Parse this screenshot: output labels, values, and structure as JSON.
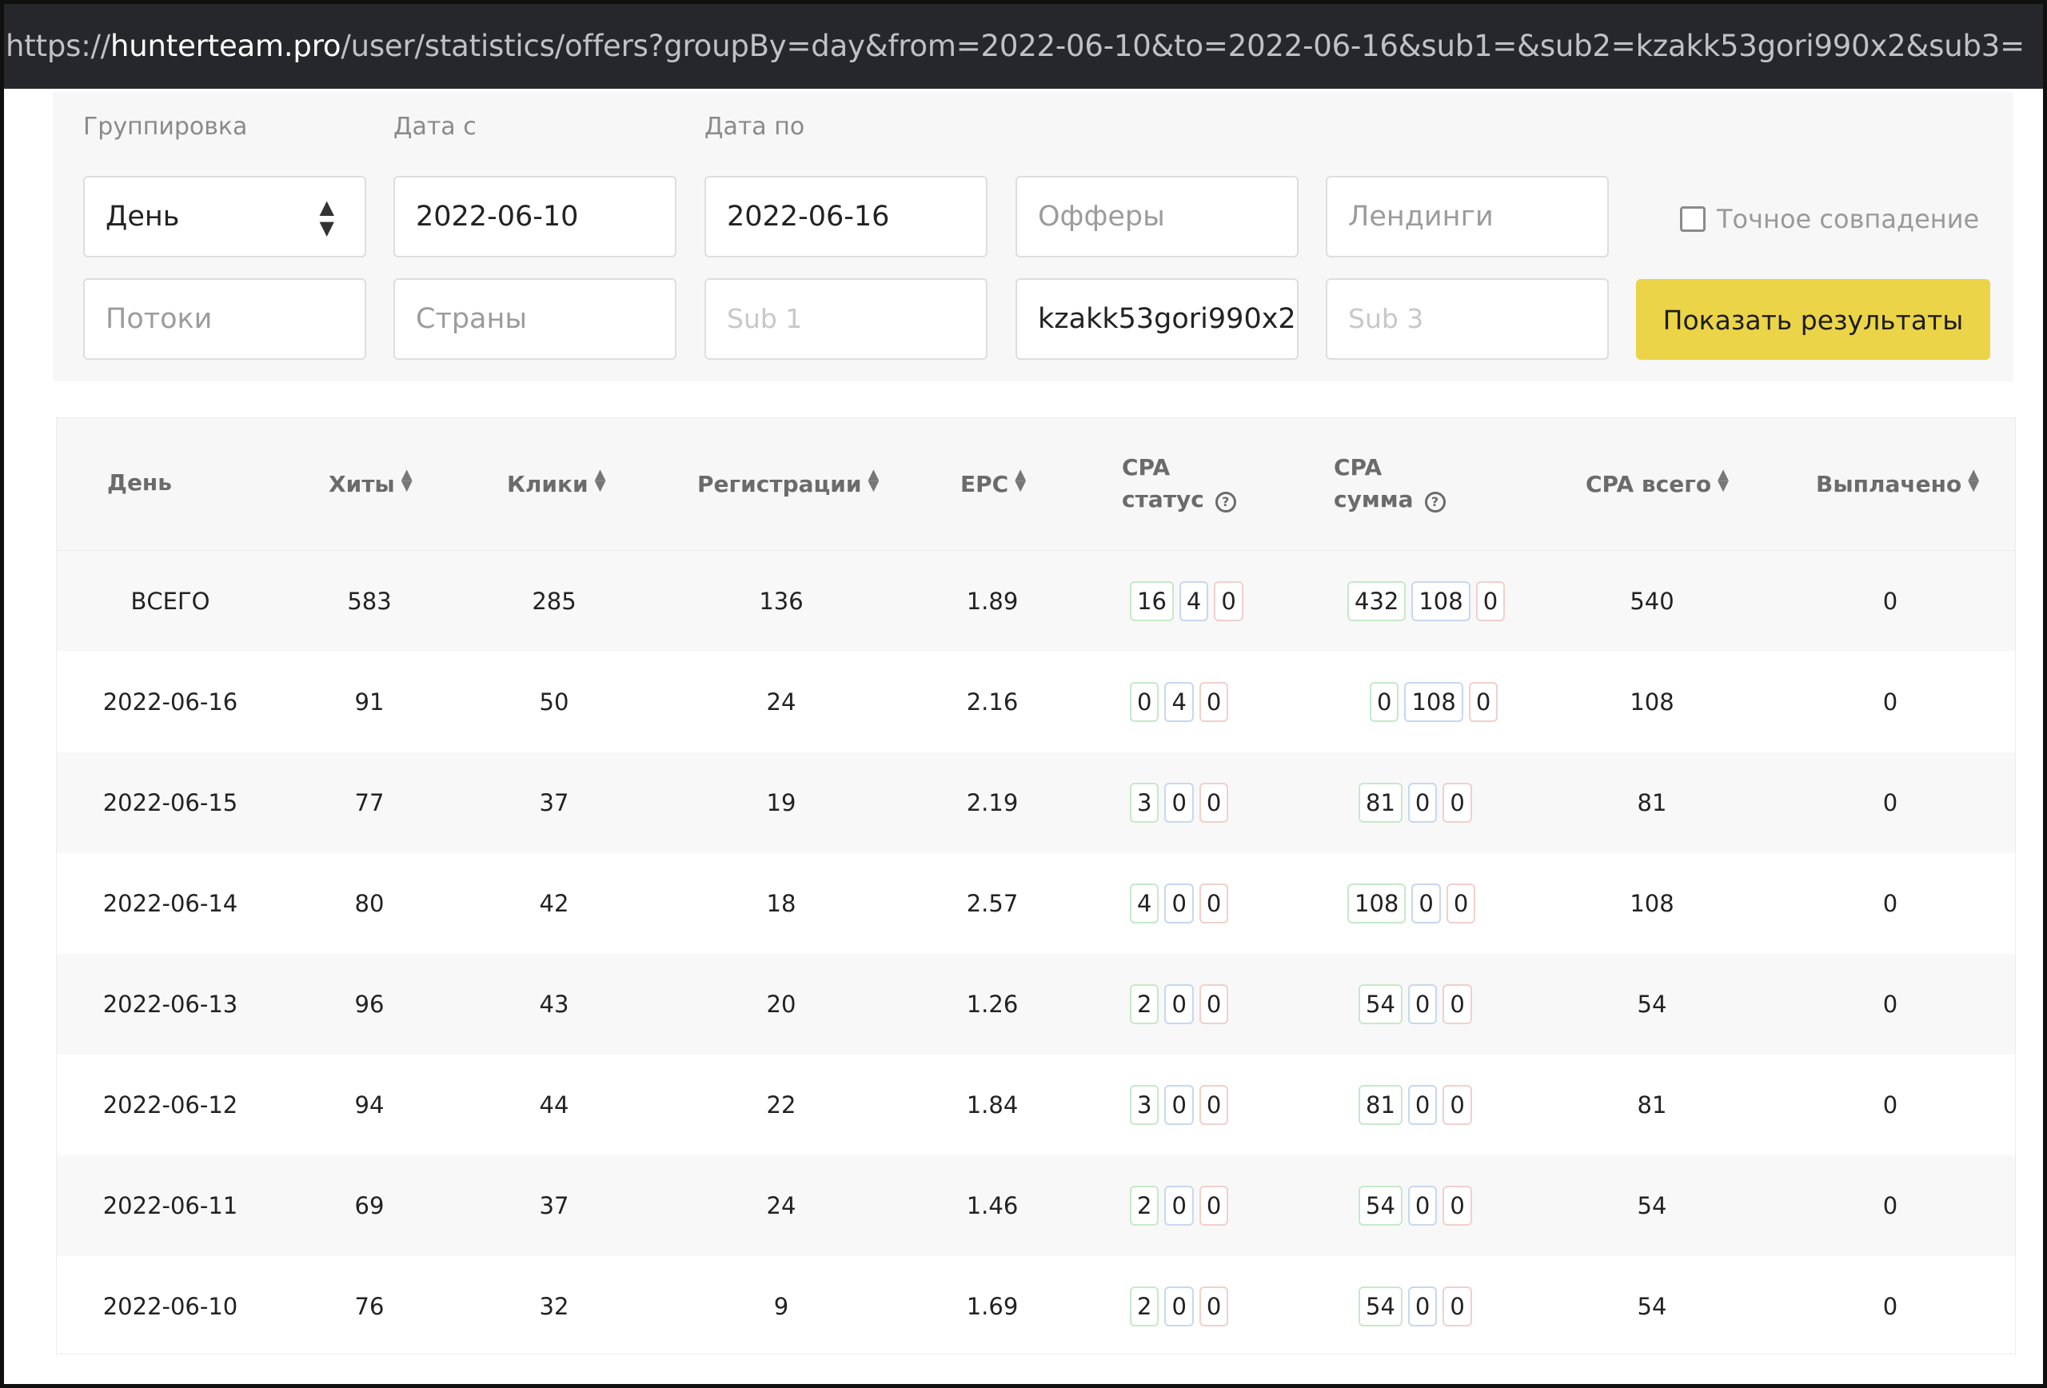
{
  "url": {
    "prefix": "https://",
    "host": "hunterteam.pro",
    "path": "/user/statistics/offers?groupBy=day&from=2022-06-10&to=2022-06-16&sub1=&sub2=kzakk53gori990x2&sub3="
  },
  "filters": {
    "grouping_label": "Группировка",
    "grouping_value": "День",
    "date_from_label": "Дата с",
    "date_from_value": "2022-06-10",
    "date_to_label": "Дата по",
    "date_to_value": "2022-06-16",
    "offers_placeholder": "Офферы",
    "landings_placeholder": "Лендинги",
    "exact_match_label": "Точное совпадение",
    "streams_placeholder": "Потоки",
    "countries_placeholder": "Страны",
    "sub1_placeholder": "Sub 1",
    "sub2_value": "kzakk53gori990x2",
    "sub3_placeholder": "Sub 3",
    "show_button": "Показать результаты"
  },
  "table": {
    "headers": {
      "day": "День",
      "hits": "Хиты",
      "clicks": "Клики",
      "registrations": "Регистрации",
      "epc": "EPC",
      "cpa_status_1": "CPA",
      "cpa_status_2": "статус",
      "cpa_sum_1": "CPA",
      "cpa_sum_2": "сумма",
      "cpa_total": "CPA всего",
      "paid": "Выплачено"
    },
    "rows": [
      {
        "day": "ВСЕГО",
        "hits": "583",
        "clicks": "285",
        "regs": "136",
        "epc": "1.89",
        "st": [
          "16",
          "4",
          "0"
        ],
        "sum": [
          "432",
          "108",
          "0"
        ],
        "total": "540",
        "paid": "0"
      },
      {
        "day": "2022-06-16",
        "hits": "91",
        "clicks": "50",
        "regs": "24",
        "epc": "2.16",
        "st": [
          "0",
          "4",
          "0"
        ],
        "sum": [
          "0",
          "108",
          "0"
        ],
        "total": "108",
        "paid": "0"
      },
      {
        "day": "2022-06-15",
        "hits": "77",
        "clicks": "37",
        "regs": "19",
        "epc": "2.19",
        "st": [
          "3",
          "0",
          "0"
        ],
        "sum": [
          "81",
          "0",
          "0"
        ],
        "total": "81",
        "paid": "0"
      },
      {
        "day": "2022-06-14",
        "hits": "80",
        "clicks": "42",
        "regs": "18",
        "epc": "2.57",
        "st": [
          "4",
          "0",
          "0"
        ],
        "sum": [
          "108",
          "0",
          "0"
        ],
        "total": "108",
        "paid": "0"
      },
      {
        "day": "2022-06-13",
        "hits": "96",
        "clicks": "43",
        "regs": "20",
        "epc": "1.26",
        "st": [
          "2",
          "0",
          "0"
        ],
        "sum": [
          "54",
          "0",
          "0"
        ],
        "total": "54",
        "paid": "0"
      },
      {
        "day": "2022-06-12",
        "hits": "94",
        "clicks": "44",
        "regs": "22",
        "epc": "1.84",
        "st": [
          "3",
          "0",
          "0"
        ],
        "sum": [
          "81",
          "0",
          "0"
        ],
        "total": "81",
        "paid": "0"
      },
      {
        "day": "2022-06-11",
        "hits": "69",
        "clicks": "37",
        "regs": "24",
        "epc": "1.46",
        "st": [
          "2",
          "0",
          "0"
        ],
        "sum": [
          "54",
          "0",
          "0"
        ],
        "total": "54",
        "paid": "0"
      },
      {
        "day": "2022-06-10",
        "hits": "76",
        "clicks": "32",
        "regs": "9",
        "epc": "1.69",
        "st": [
          "2",
          "0",
          "0"
        ],
        "sum": [
          "54",
          "0",
          "0"
        ],
        "total": "54",
        "paid": "0"
      }
    ]
  },
  "icons": {
    "sort": "sort-icon",
    "help": "help-circle-icon",
    "select": "select-arrows-icon"
  },
  "colors": {
    "button": "#ebd448",
    "badge_green": "#c6e9c8",
    "badge_blue": "#c7d8ef",
    "badge_red": "#f1d0cc"
  }
}
